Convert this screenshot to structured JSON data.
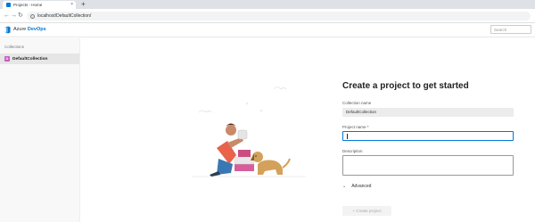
{
  "browser": {
    "tab_title": "Projects - Home",
    "tab_close": "×",
    "new_tab": "+",
    "url": "localhost/DefaultCollection/"
  },
  "app": {
    "brand_prefix": "Azure ",
    "brand_name": "DevOps",
    "search_placeholder": "Search"
  },
  "sidebar": {
    "heading": "Collections",
    "items": [
      {
        "avatar": "D",
        "label": "DefaultCollection",
        "selected": true
      }
    ]
  },
  "form": {
    "title": "Create a project to get started",
    "collection_label": "Collection name",
    "collection_value": "DefaultCollection",
    "project_name_label": "Project name *",
    "project_name_value": "",
    "description_label": "Description",
    "description_value": "",
    "advanced_label": "Advanced",
    "create_button": "+ Create project"
  },
  "colors": {
    "accent": "#0078d4",
    "collection_avatar": "#c55dc0"
  },
  "icons": {
    "back": "back-arrow-icon",
    "forward": "forward-arrow-icon",
    "reload": "reload-icon",
    "info": "info-icon",
    "brand": "azure-devops-logo-icon",
    "chevron": "chevron-down-icon"
  }
}
